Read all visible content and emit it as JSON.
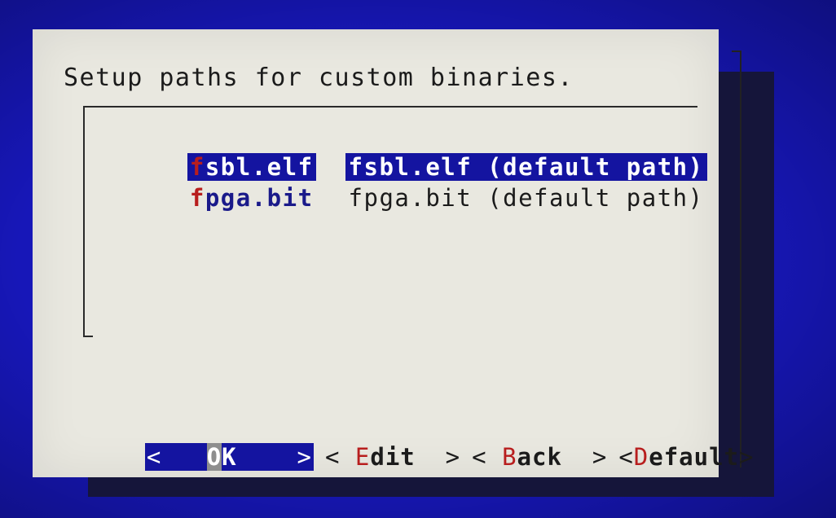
{
  "dialog": {
    "title": "Setup paths for custom binaries."
  },
  "list": {
    "items": [
      {
        "tag_hot": "f",
        "tag_rest": "sbl.elf",
        "value": "fsbl.elf (default path)",
        "selected": true
      },
      {
        "tag_hot": "f",
        "tag_rest": "pga.bit",
        "value": "fpga.bit (default path)",
        "selected": false
      }
    ]
  },
  "buttons": {
    "ok": {
      "open": "<",
      "hot": "O",
      "rest": "K",
      "close": ">"
    },
    "edit": {
      "open": "<",
      "hot": "E",
      "rest": "dit",
      "close": ">"
    },
    "back": {
      "open": "<",
      "hot": "B",
      "rest": "ack",
      "close": ">"
    },
    "default": {
      "open": "<",
      "hot": "D",
      "rest": "efault",
      "close": ">"
    }
  },
  "colors": {
    "screen_background": "#1717b8",
    "dialog_background": "#e9e8e0",
    "selection": "#1414a0",
    "hotkey": "#b81e1e"
  }
}
